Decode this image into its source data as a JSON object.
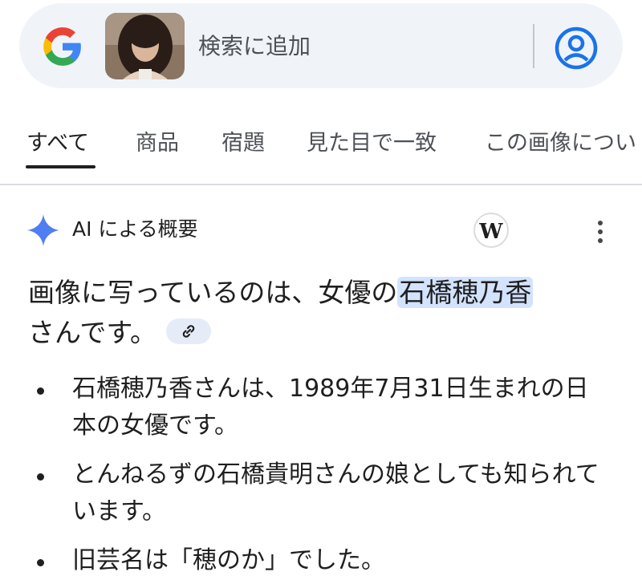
{
  "search": {
    "query_text": "検索に追加",
    "logo_icon": "google-g-icon",
    "account_icon": "account-circle-icon"
  },
  "tabs": [
    {
      "label": "すべて",
      "active": true
    },
    {
      "label": "商品",
      "active": false
    },
    {
      "label": "宿題",
      "active": false
    },
    {
      "label": "見た目で一致",
      "active": false
    },
    {
      "label": "この画像につい",
      "active": false
    }
  ],
  "ai_overview": {
    "title": "AI による概要",
    "source_badge": "W",
    "headline_before": "画像に写っているのは、女優の",
    "headline_highlight": "石橋穂乃香",
    "headline_after": "さんです。",
    "bullets": [
      "石橋穂乃香さんは、1989年7月31日生まれの日本の女優です。",
      "とんねるずの石橋貴明さんの娘としても知られています。",
      "旧芸名は「穂のか」でした。"
    ]
  },
  "colors": {
    "accent_blue": "#1a73e8",
    "highlight": "#d3e3fd",
    "searchbar_bg": "#f0f4f9"
  }
}
